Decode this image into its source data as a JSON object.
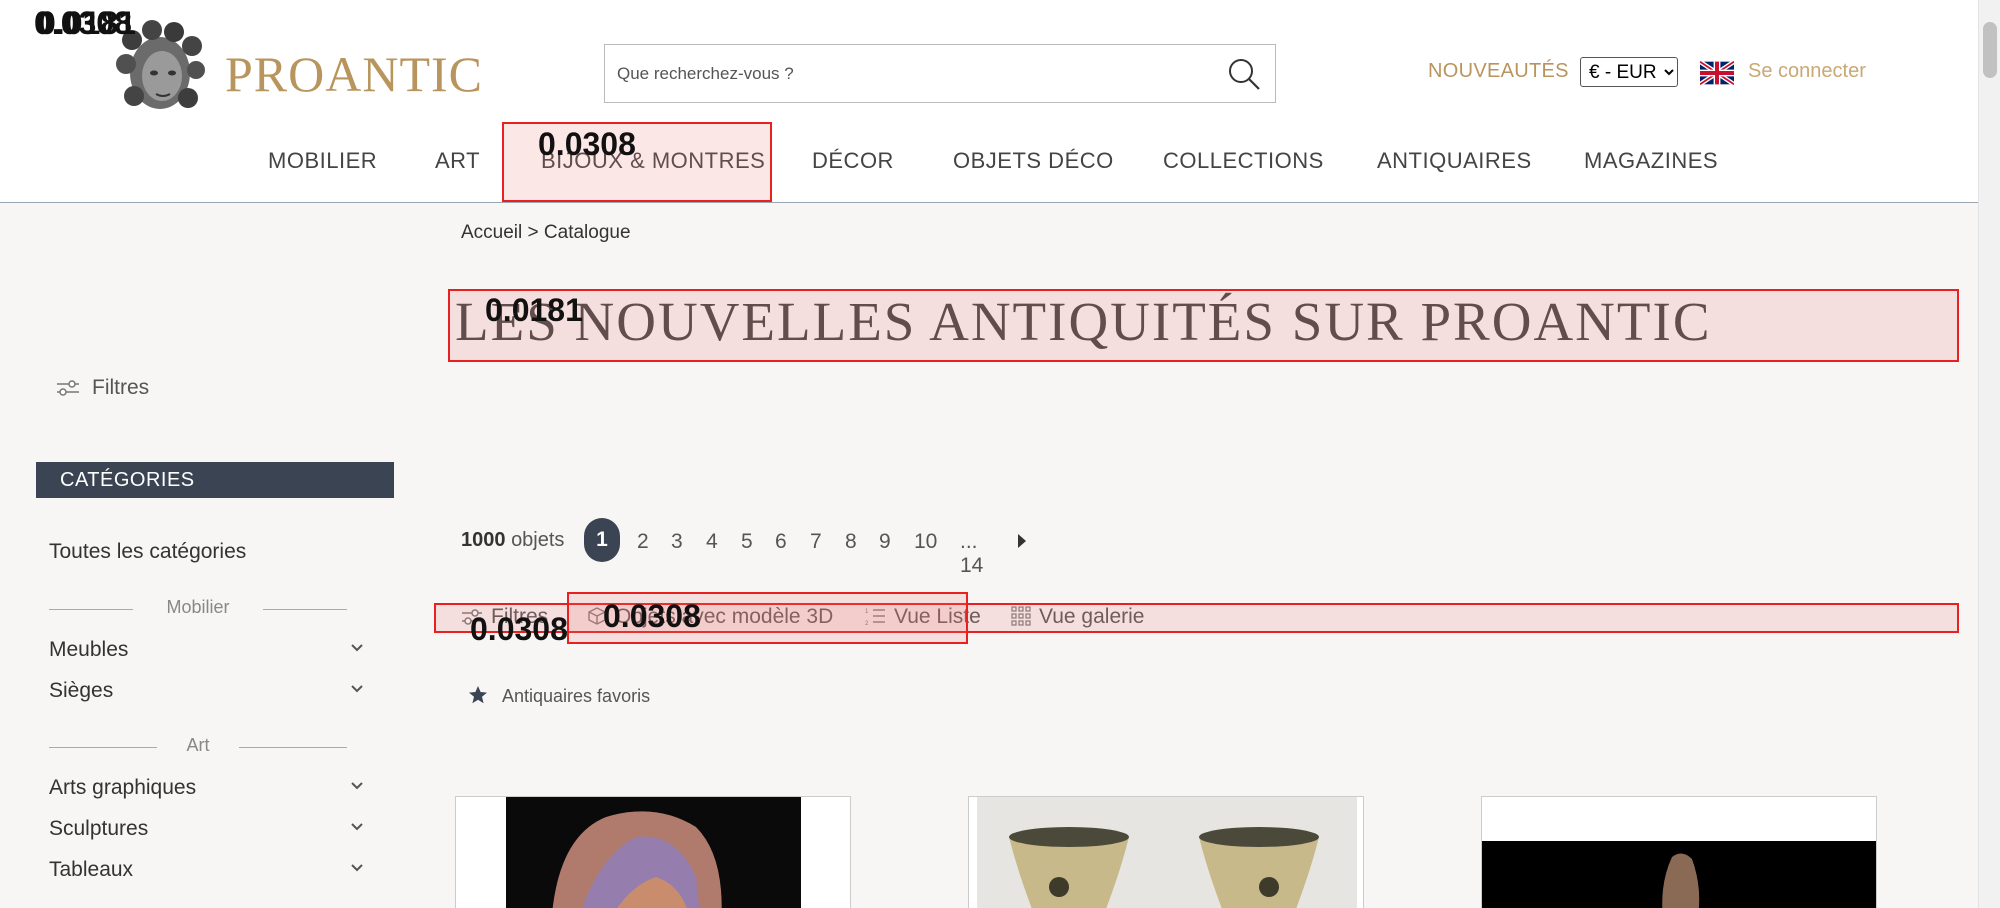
{
  "header": {
    "brand": "PROANTIC",
    "search_placeholder": "Que recherchez-vous ?",
    "nouveautes": "NOUVEAUTÉS",
    "currency": "€ - EUR",
    "login": "Se connecter"
  },
  "nav": [
    "MOBILIER",
    "ART",
    "BIJOUX & MONTRES",
    "DÉCOR",
    "OBJETS DÉCO",
    "COLLECTIONS",
    "ANTIQUAIRES",
    "MAGAZINES"
  ],
  "breadcrumb": {
    "home": "Accueil",
    "sep": ">",
    "current": "Catalogue"
  },
  "title": "LES NOUVELLES ANTIQUITÉS SUR PROANTIC",
  "sidebar": {
    "filters": "Filtres",
    "categories_heading": "CATÉGORIES",
    "all": "Toutes les catégories",
    "groups": [
      {
        "name": "Mobilier",
        "items": [
          "Meubles",
          "Sièges"
        ]
      },
      {
        "name": "Art",
        "items": [
          "Arts graphiques",
          "Sculptures",
          "Tableaux"
        ]
      }
    ]
  },
  "results": {
    "count": "1000",
    "count_suffix": "objets",
    "pages": [
      "1",
      "2",
      "3",
      "4",
      "5",
      "6",
      "7",
      "8",
      "9",
      "10",
      "... 14"
    ],
    "active_page": "1"
  },
  "toolbar": {
    "filters": "Filtres",
    "model3d": "Objets avec modèle 3D",
    "list_view": "Vue Liste",
    "gallery_view": "Vue galerie"
  },
  "favorites": "Antiquaires favoris",
  "annotations": [
    "0.0308",
    "0.0308",
    "0.0181",
    "0.0308",
    "0.0308"
  ],
  "colors": {
    "gold": "#b9955e",
    "dark": "#3b4452",
    "highlight": "#e8201f"
  }
}
